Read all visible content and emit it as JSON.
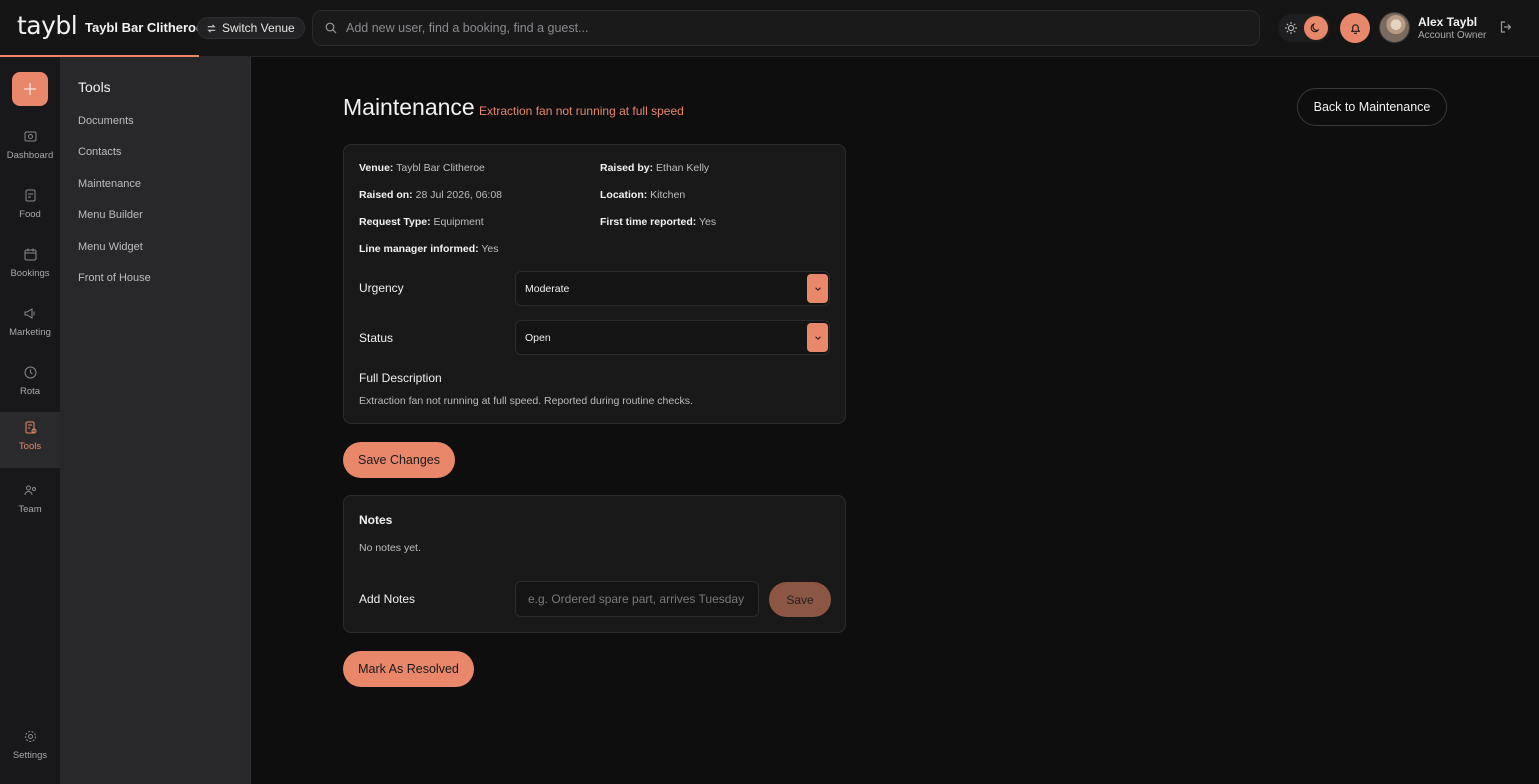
{
  "app": {
    "logo": "taybl",
    "venue_name": "Taybl Bar Clitheroe",
    "switch_venue_label": "Switch Venue",
    "accent_color": "#e8876a"
  },
  "search": {
    "placeholder": "Add new user, find a booking, find a guest..."
  },
  "user": {
    "name": "Alex Taybl",
    "role": "Account Owner"
  },
  "rail": {
    "items": [
      {
        "label": "Dashboard",
        "icon": "dashboard-icon"
      },
      {
        "label": "Food",
        "icon": "food-icon"
      },
      {
        "label": "Bookings",
        "icon": "bookings-icon"
      },
      {
        "label": "Marketing",
        "icon": "megaphone-icon"
      },
      {
        "label": "Rota",
        "icon": "rota-icon"
      },
      {
        "label": "Tools",
        "icon": "tools-icon",
        "active": true
      },
      {
        "label": "Team",
        "icon": "team-icon"
      }
    ],
    "settings_label": "Settings"
  },
  "subnav": {
    "title": "Tools",
    "items": [
      "Documents",
      "Contacts",
      "Maintenance",
      "Menu Builder",
      "Menu Widget",
      "Front of House"
    ]
  },
  "page": {
    "title": "Maintenance",
    "subtitle": "Extraction fan not running at full speed",
    "back_label": "Back to Maintenance"
  },
  "details": {
    "venue": {
      "label": "Venue:",
      "value": "Taybl Bar Clitheroe"
    },
    "raised_by": {
      "label": "Raised by:",
      "value": "Ethan Kelly"
    },
    "raised_on": {
      "label": "Raised on:",
      "value": "28 Jul 2026, 06:08"
    },
    "location": {
      "label": "Location:",
      "value": "Kitchen"
    },
    "request_type": {
      "label": "Request Type:",
      "value": "Equipment"
    },
    "first_time": {
      "label": "First time reported:",
      "value": "Yes"
    },
    "line_manager": {
      "label": "Line manager informed:",
      "value": "Yes"
    },
    "urgency": {
      "label": "Urgency",
      "value": "Moderate"
    },
    "status": {
      "label": "Status",
      "value": "Open"
    },
    "description": {
      "label": "Full Description",
      "value": "Extraction fan not running at full speed. Reported during routine checks."
    }
  },
  "save_changes_label": "Save Changes",
  "notes": {
    "title": "Notes",
    "empty": "No notes yet.",
    "add_label": "Add Notes",
    "placeholder": "e.g. Ordered spare part, arrives Tuesday",
    "save_label": "Save"
  },
  "resolve_label": "Mark As Resolved"
}
